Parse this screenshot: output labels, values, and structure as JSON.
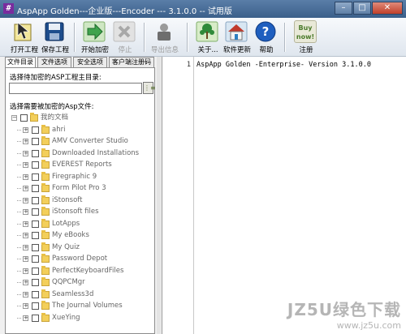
{
  "window": {
    "title": "AspApp Golden---企业版---Encoder --- 3.1.0.0 -- 试用版",
    "minimize_glyph": "–",
    "maximize_glyph": "□",
    "close_glyph": "✕",
    "app_icon_glyph": "#"
  },
  "toolbar": {
    "buttons": [
      {
        "id": "open-project",
        "label": "打开工程",
        "icon": "open-project-icon",
        "disabled": false
      },
      {
        "id": "save-project",
        "label": "保存工程",
        "icon": "save-disk-icon",
        "disabled": false
      },
      {
        "id": "start-encrypt",
        "label": "开始加密",
        "icon": "arrow-right-icon",
        "disabled": false
      },
      {
        "id": "stop",
        "label": "停止",
        "icon": "stop-x-icon",
        "disabled": true
      },
      {
        "id": "export-info",
        "label": "导出信息",
        "icon": "export-icon",
        "disabled": true
      },
      {
        "id": "about",
        "label": "关于...",
        "icon": "about-tree-icon",
        "disabled": false
      },
      {
        "id": "software-update",
        "label": "软件更新",
        "icon": "house-update-icon",
        "disabled": false
      },
      {
        "id": "help",
        "label": "帮助",
        "icon": "help-question-icon",
        "disabled": false
      },
      {
        "id": "register",
        "label": "注册",
        "icon": "buy-now-icon",
        "disabled": false,
        "badge_line1": "Buy",
        "badge_line2": "now!"
      }
    ]
  },
  "tabs": [
    {
      "label": "文件目录",
      "active": true
    },
    {
      "label": "文件选项",
      "active": false
    },
    {
      "label": "安全选项",
      "active": false
    },
    {
      "label": "客户端注册码",
      "active": false
    }
  ],
  "left_panel": {
    "project_dir_label": "选择待加密的ASP工程主目录:",
    "project_dir_value": "",
    "browse_glyph": "⋮≡",
    "files_label": "选择需要被加密的Asp文件:",
    "tree_root": {
      "label": "我的文档"
    },
    "tree_items": [
      "ahri",
      "AMV Converter Studio",
      "Downloaded Installations",
      "EVEREST Reports",
      "Firegraphic 9",
      "Form Pilot Pro 3",
      "iStonsoft",
      "iStonsoft files",
      "LotApps",
      "My eBooks",
      "My Quiz",
      "Password Depot",
      "PerfectKeyboardFiles",
      "QQPCMgr",
      "Seamless3d",
      "The Journal Volumes",
      "XueYing"
    ]
  },
  "editor": {
    "lines": [
      {
        "no": "1",
        "text": "AspApp Golden -Enterprise- Version 3.1.0.0"
      }
    ]
  },
  "watermark": {
    "line1": "JZ5U绿色下载",
    "line2": "www.jz5u.com"
  },
  "colors": {
    "title_bar": "#3b5f8a",
    "folder": "#f3cf5a",
    "help_blue": "#1f5fbf"
  }
}
